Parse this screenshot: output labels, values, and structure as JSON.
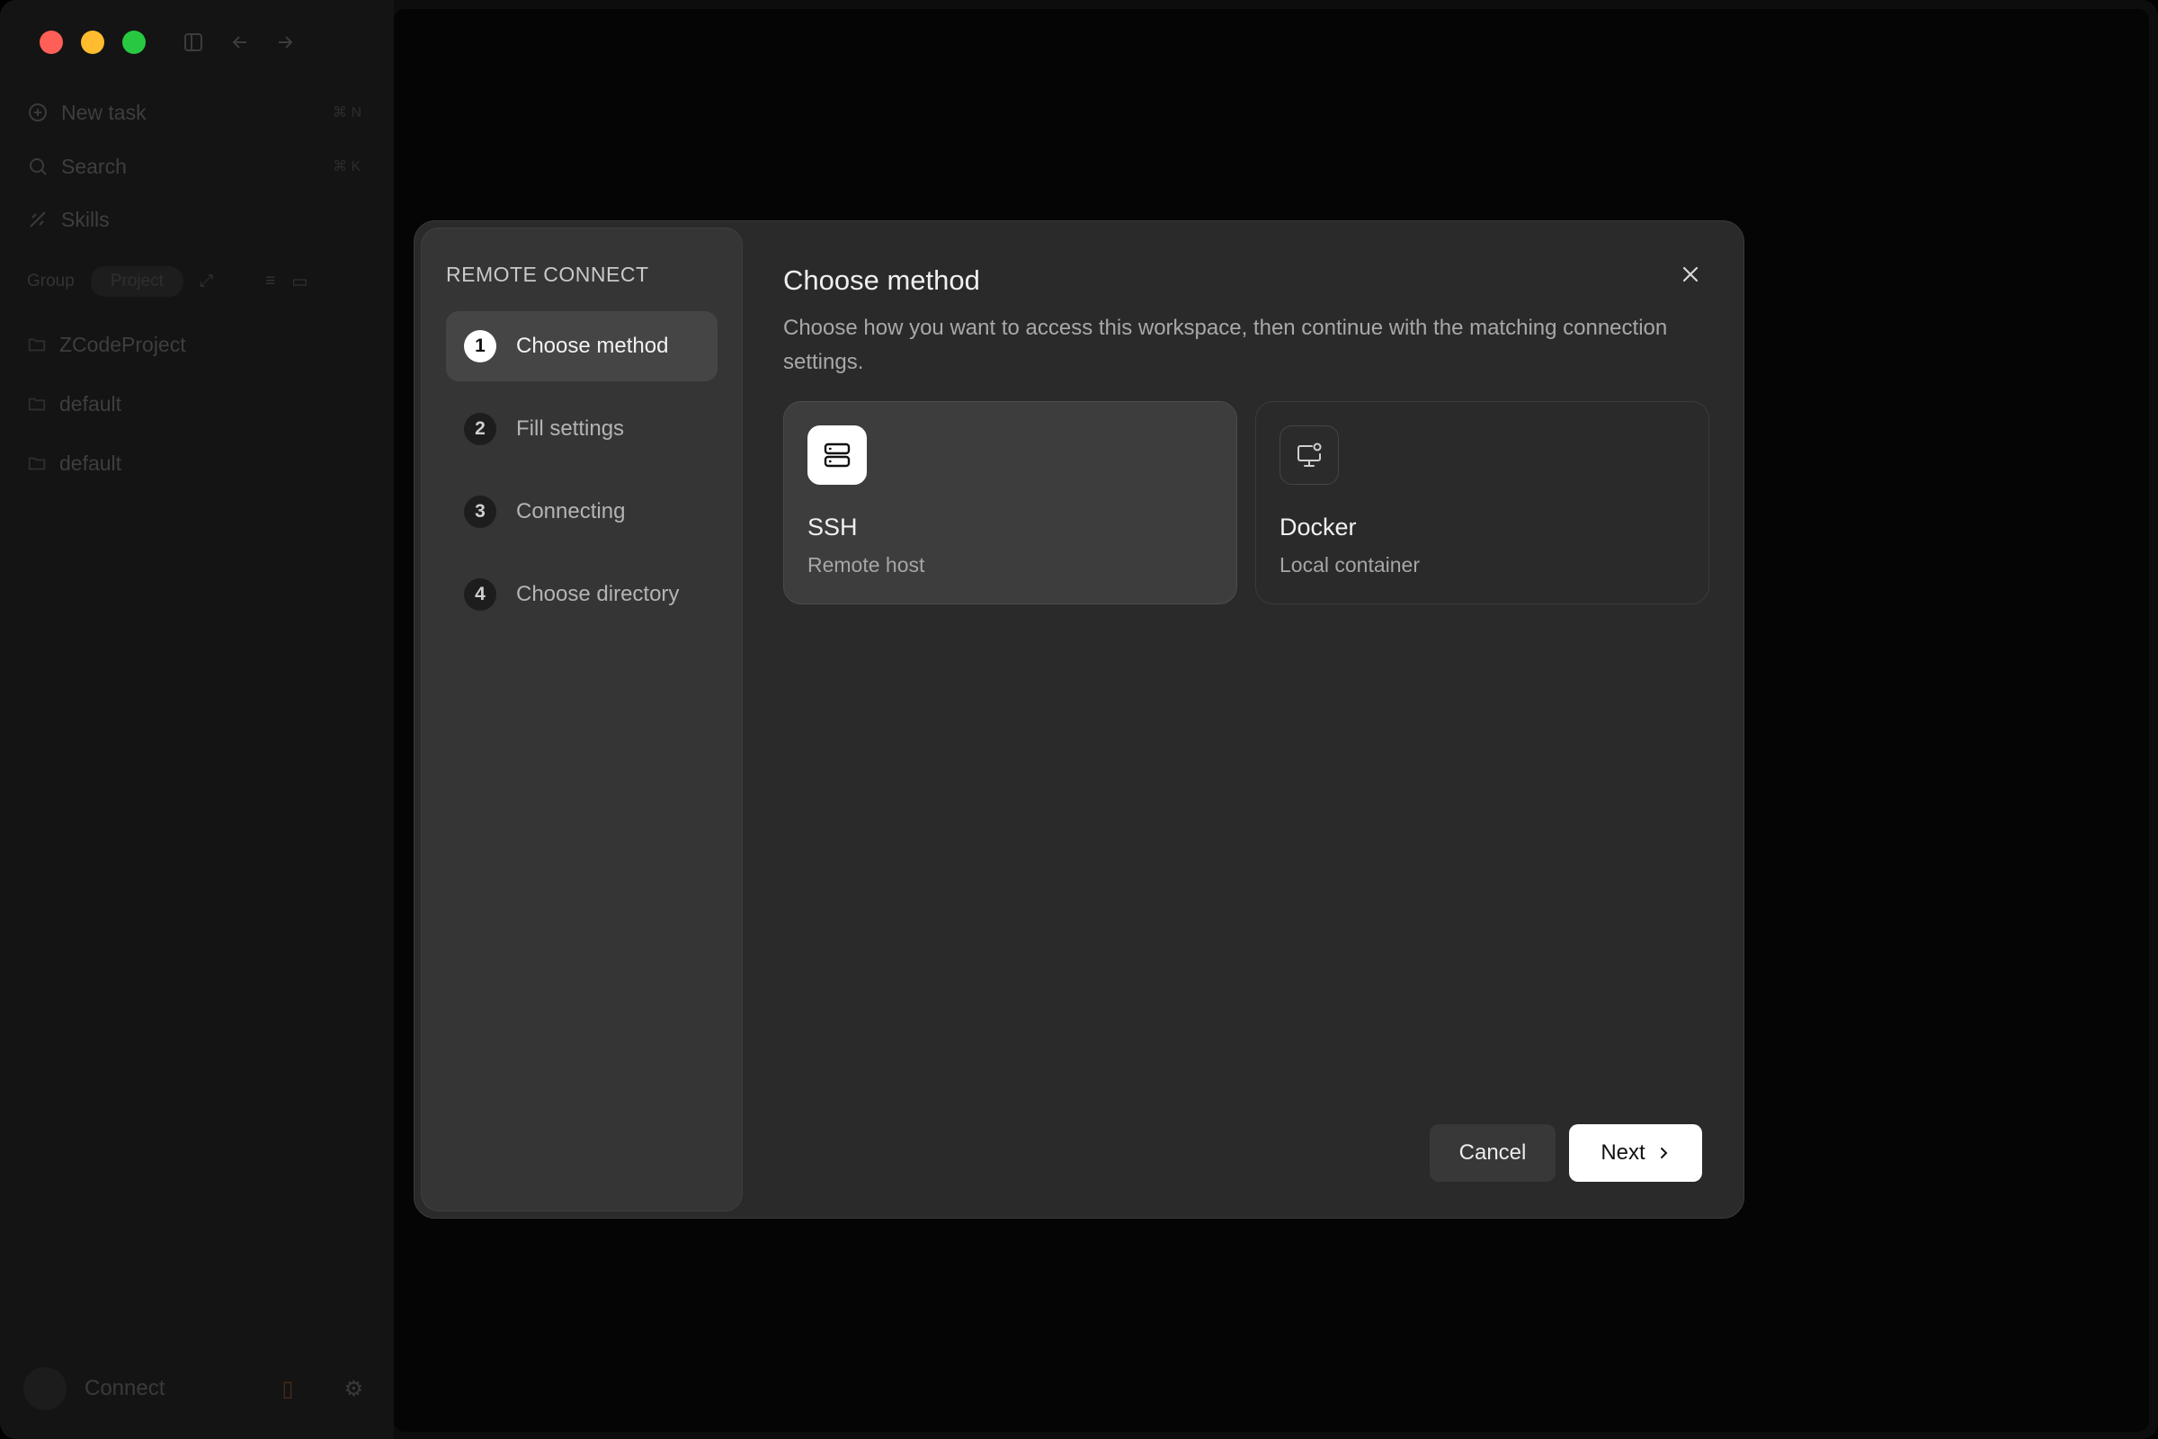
{
  "sidebar": {
    "new_task": "New task",
    "new_task_shortcut": "⌘ N",
    "search": "Search",
    "search_shortcut": "⌘ K",
    "skills": "Skills",
    "group_label": "Group",
    "project_pill": "Project",
    "projects": [
      "ZCodeProject",
      "default",
      "default"
    ],
    "connect": "Connect"
  },
  "modal": {
    "steps_title": "REMOTE CONNECT",
    "steps": [
      {
        "num": "1",
        "label": "Choose method",
        "active": true
      },
      {
        "num": "2",
        "label": "Fill settings",
        "active": false
      },
      {
        "num": "3",
        "label": "Connecting",
        "active": false
      },
      {
        "num": "4",
        "label": "Choose directory",
        "active": false
      }
    ],
    "title": "Choose method",
    "description": "Choose how you want to access this workspace, then continue with the matching connection settings.",
    "options": [
      {
        "name": "SSH",
        "subtitle": "Remote host",
        "icon": "server-icon",
        "selected": true
      },
      {
        "name": "Docker",
        "subtitle": "Local container",
        "icon": "monitor-container-icon",
        "selected": false
      }
    ],
    "cancel_label": "Cancel",
    "next_label": "Next"
  }
}
